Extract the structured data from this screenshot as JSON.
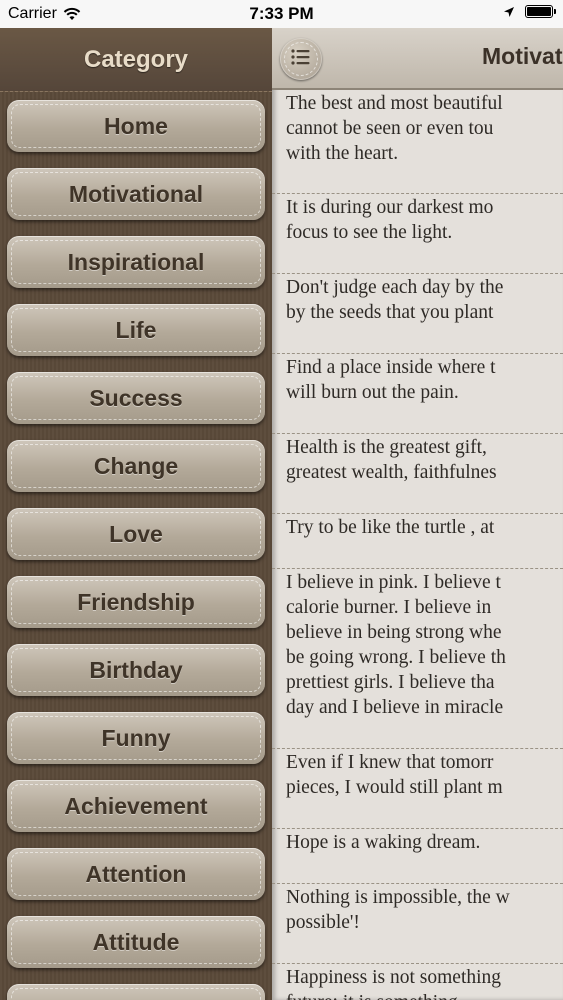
{
  "status": {
    "carrier": "Carrier",
    "time": "7:33 PM"
  },
  "sidebar": {
    "title": "Category",
    "items": [
      "Home",
      "Motivational",
      "Inspirational",
      "Life",
      "Success",
      "Change",
      "Love",
      "Friendship",
      "Birthday",
      "Funny",
      "Achievement",
      "Attention",
      "Attitude",
      ""
    ]
  },
  "main": {
    "title": "Motivational",
    "quotes": [
      {
        "lines": [
          "The best and most beautiful",
          "cannot be seen or even tou",
          "with the heart."
        ]
      },
      {
        "lines": [
          "It is during our darkest mo",
          "focus to see the light."
        ]
      },
      {
        "lines": [
          "Don't judge each day by the",
          "by the seeds that you plant"
        ]
      },
      {
        "lines": [
          "Find a place inside where t",
          "will burn out the pain."
        ]
      },
      {
        "lines": [
          "Health is the greatest gift,",
          "greatest wealth, faithfulnes"
        ]
      },
      {
        "lines": [
          "Try to be like the turtle , at"
        ]
      },
      {
        "lines": [
          "I believe in pink. I believe t",
          "calorie burner. I believe in",
          "believe in being strong whe",
          "be going wrong. I believe th",
          "prettiest girls. I believe tha",
          "day and I believe in miracle"
        ]
      },
      {
        "lines": [
          "Even if I knew that tomorr",
          "pieces, I would still plant m"
        ]
      },
      {
        "lines": [
          "Hope is a waking dream."
        ]
      },
      {
        "lines": [
          "Nothing is impossible, the w",
          "possible'!"
        ]
      },
      {
        "lines": [
          "Happiness is not something",
          "future; it is something"
        ]
      }
    ]
  },
  "icons": {
    "wifi": "wifi-icon",
    "location": "location-arrow-icon",
    "battery": "battery-icon",
    "menu": "list-menu-icon"
  },
  "colors": {
    "sidebar_bg": "#5b4a3a",
    "button_text": "#3f3428",
    "main_bg": "#e4e0db"
  }
}
